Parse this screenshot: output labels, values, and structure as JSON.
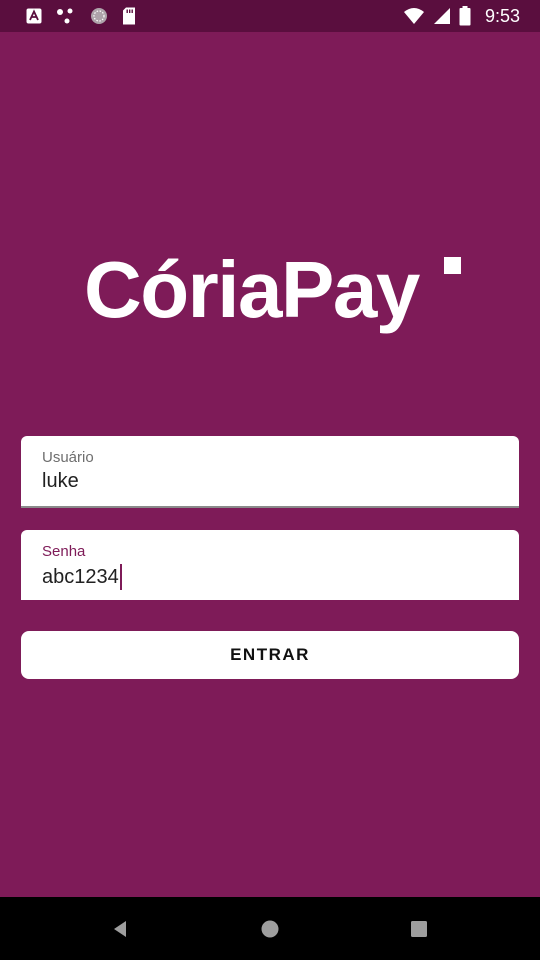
{
  "status_bar": {
    "time": "9:53",
    "left_icons": [
      "font-a-icon",
      "dots-icon",
      "circle-badge-icon",
      "sd-card-icon"
    ],
    "right_icons": [
      "wifi-icon",
      "cell-signal-icon",
      "battery-icon"
    ]
  },
  "logo": {
    "text": "CóriaPay"
  },
  "login": {
    "username": {
      "label": "Usuário",
      "value": "luke"
    },
    "password": {
      "label": "Senha",
      "value": "abc1234"
    },
    "submit_label": "ENTRAR"
  },
  "nav_bar": {
    "buttons": [
      "back-icon",
      "home-icon",
      "recents-icon"
    ]
  },
  "colors": {
    "background": "#7e1b58",
    "status_bar": "#5a0e3e",
    "accent": "#7e1b58",
    "surface": "#ffffff"
  }
}
